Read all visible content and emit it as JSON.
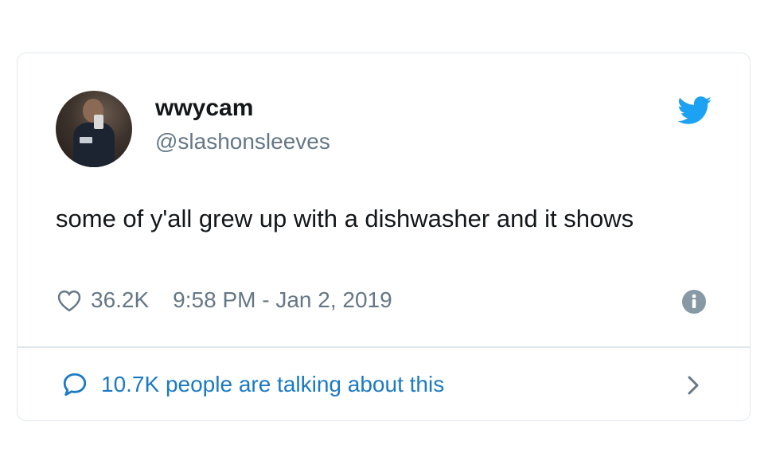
{
  "tweet": {
    "user_name": "wwycam",
    "user_handle": "@slashonsleeves",
    "text": "some of y'all grew up with a dishwasher and it shows",
    "like_count": "36.2K",
    "timestamp": "9:58 PM - Jan 2, 2019",
    "talking_text": "10.7K people are talking about this"
  },
  "icons": {
    "brand": "twitter-bird-icon",
    "like": "heart-icon",
    "info": "info-icon",
    "conversation": "speech-bubble-icon",
    "more": "chevron-right-icon"
  },
  "colors": {
    "twitter_blue": "#1da1f2",
    "link_blue": "#1b7ac4",
    "secondary_text": "#657786",
    "border": "#e1e8ed"
  }
}
